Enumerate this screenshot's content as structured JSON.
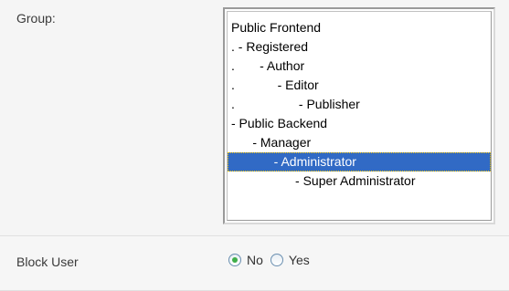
{
  "group": {
    "label": "Group:",
    "options": [
      {
        "text": "Public Frontend",
        "selected": false
      },
      {
        "text": ". - Registered",
        "selected": false
      },
      {
        "text": ".       - Author",
        "selected": false
      },
      {
        "text": ".            - Editor",
        "selected": false
      },
      {
        "text": ".                  - Publisher",
        "selected": false
      },
      {
        "text": "- Public Backend",
        "selected": false
      },
      {
        "text": "      - Manager",
        "selected": false
      },
      {
        "text": "            - Administrator",
        "selected": true
      },
      {
        "text": "                  - Super Administrator",
        "selected": false
      }
    ]
  },
  "block_user": {
    "label": "Block User",
    "options": [
      {
        "label": "No",
        "checked": true
      },
      {
        "label": "Yes",
        "checked": false
      }
    ]
  },
  "colors": {
    "selection": "#316ac5",
    "radio_checked": "#3fae49"
  }
}
